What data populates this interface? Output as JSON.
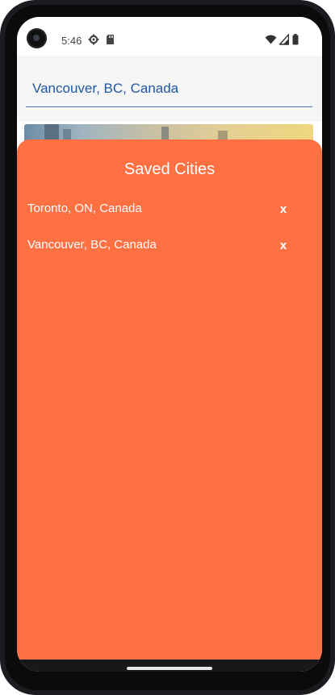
{
  "status_bar": {
    "time": "5:46",
    "icons": [
      "camera-lens",
      "gear-icon",
      "sdcard-icon",
      "wifi-icon",
      "signal-icon",
      "battery-icon"
    ]
  },
  "search": {
    "value": "Vancouver, BC, Canada",
    "placeholder": ""
  },
  "saved_cities": {
    "title": "Saved Cities",
    "remove_label": "x",
    "items": [
      {
        "label": "Toronto, ON, Canada"
      },
      {
        "label": "Vancouver, BC, Canada"
      }
    ]
  },
  "colors": {
    "sheet_background": "#ff7043",
    "input_text": "#1f56a6",
    "input_underline": "#4a78b8",
    "text_on_sheet": "#ffffff"
  }
}
